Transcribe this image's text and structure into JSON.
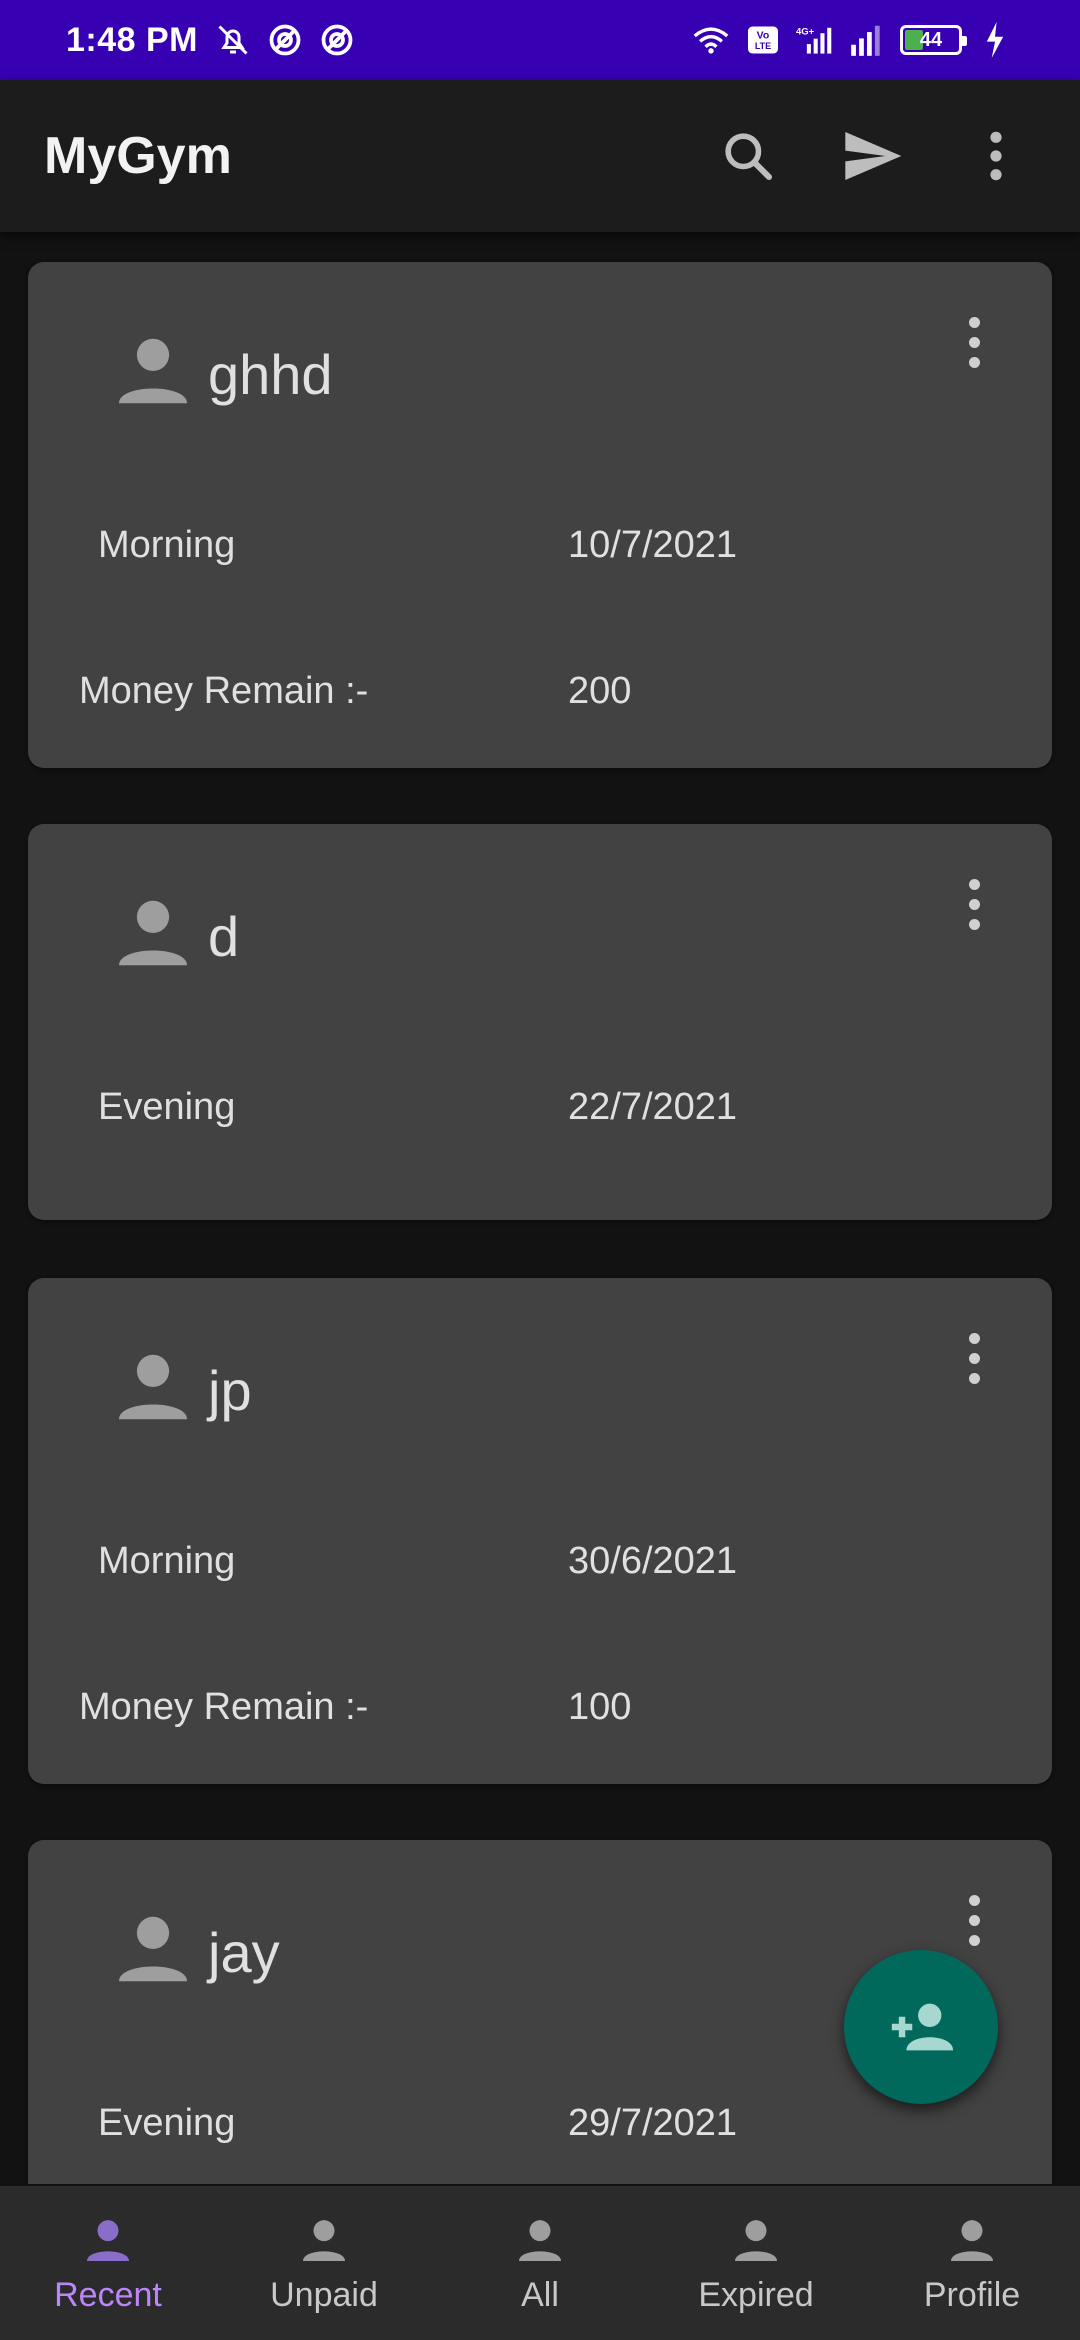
{
  "status_bar": {
    "time": "1:48 PM",
    "left_icons": [
      "mute-icon",
      "focus-icon",
      "focus-icon"
    ],
    "right_icons": [
      "wifi-icon",
      "volte-icon",
      "signal-icon",
      "signal-icon"
    ],
    "battery_level": "44",
    "charging": true
  },
  "app_bar": {
    "title": "MyGym",
    "actions": [
      "search-icon",
      "send-icon",
      "more-vert-icon"
    ]
  },
  "members": [
    {
      "name": "ghhd",
      "shift": "Morning",
      "date": "10/7/2021",
      "money_label": "Money Remain :-",
      "money_value": "200"
    },
    {
      "name": "d",
      "shift": "Evening",
      "date": "22/7/2021"
    },
    {
      "name": "jp",
      "shift": "Morning",
      "date": "30/6/2021",
      "money_label": "Money Remain :-",
      "money_value": "100"
    },
    {
      "name": "jay",
      "shift": "Evening",
      "date": "29/7/2021"
    }
  ],
  "fab": {
    "icon": "add-person-icon"
  },
  "bottom_nav": {
    "active": "Recent",
    "items": [
      {
        "label": "Recent"
      },
      {
        "label": "Unpaid"
      },
      {
        "label": "All"
      },
      {
        "label": "Expired"
      },
      {
        "label": "Profile"
      }
    ]
  },
  "colors": {
    "status_bar": "#3700b3",
    "app_bar": "#1c1c1c",
    "background": "#121212",
    "card": "#424242",
    "fab": "#00695c",
    "nav_active": "#bb86fc"
  }
}
